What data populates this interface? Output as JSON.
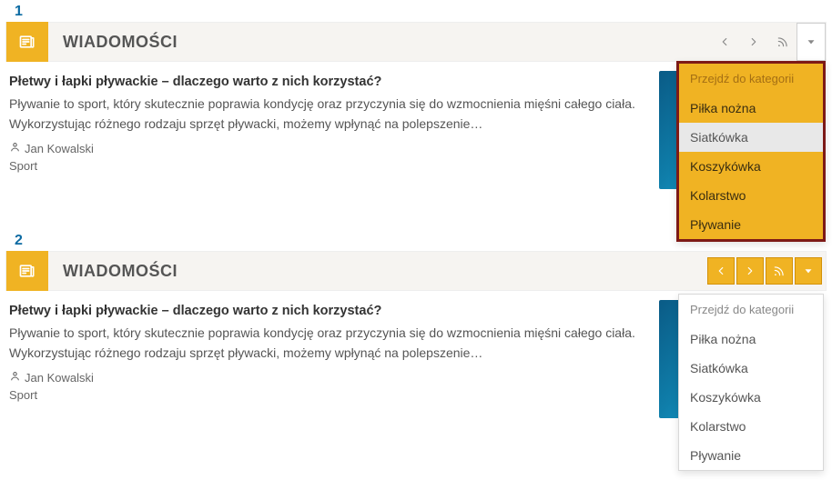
{
  "labels": {
    "one": "1",
    "two": "2"
  },
  "colors": {
    "accent": "#f0b323",
    "highlight_border": "#7d1a17"
  },
  "widget1": {
    "title": "WIADOMOŚCI",
    "article": {
      "title": "Płetwy i łapki pływackie – dlaczego warto z nich korzystać?",
      "excerpt": "Pływanie to sport, który skutecznie poprawia kondycję oraz przyczynia się do wzmocnienia mięśni całego ciała. Wykorzystując różnego rodzaju sprzęt pływacki, możemy wpłynąć na polepszenie…",
      "author": "Jan Kowalski",
      "category": "Sport"
    },
    "menu": {
      "header": "Przejdź do kategorii",
      "items": [
        "Piłka nożna",
        "Siatkówka",
        "Koszykówka",
        "Kolarstwo",
        "Pływanie"
      ],
      "hover_index": 1
    }
  },
  "widget2": {
    "title": "WIADOMOŚCI",
    "article": {
      "title": "Płetwy i łapki pływackie – dlaczego warto z nich korzystać?",
      "excerpt": "Pływanie to sport, który skutecznie poprawia kondycję oraz przyczynia się do wzmocnienia mięśni całego ciała. Wykorzystując różnego rodzaju sprzęt pływacki, możemy wpłynąć na polepszenie…",
      "author": "Jan Kowalski",
      "category": "Sport"
    },
    "menu": {
      "header": "Przejdź do kategorii",
      "items": [
        "Piłka nożna",
        "Siatkówka",
        "Koszykówka",
        "Kolarstwo",
        "Pływanie"
      ],
      "hover_index": -1
    }
  }
}
